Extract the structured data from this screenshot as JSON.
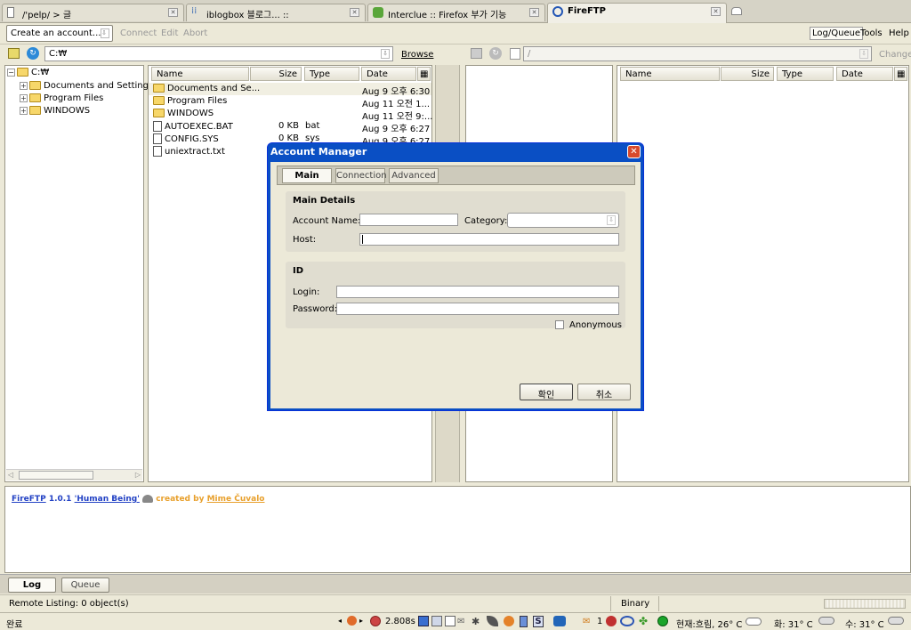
{
  "tabs": [
    {
      "label": "/'рelp/ > 글"
    },
    {
      "label": "iblogbox 블로그... ::"
    },
    {
      "label": "Interclue :: Firefox 부가 기능"
    },
    {
      "label": "FireFTP"
    }
  ],
  "toolbar": {
    "account_select": "Create an account...",
    "connect": "Connect",
    "edit": "Edit",
    "abort": "Abort",
    "log_queue": "Log/Queue",
    "tools": "Tools",
    "help": "Help"
  },
  "local": {
    "path": "C:₩",
    "browse": "Browse",
    "tree": [
      {
        "label": "C:₩"
      },
      {
        "label": "Documents and Settings"
      },
      {
        "label": "Program Files"
      },
      {
        "label": "WINDOWS"
      }
    ],
    "columns": [
      "Name",
      "Size",
      "Type",
      "Date"
    ],
    "files": [
      {
        "name": "Documents and Se...",
        "size": "",
        "type": "",
        "date": "Aug 9 오후 6:30"
      },
      {
        "name": "Program Files",
        "size": "",
        "type": "",
        "date": "Aug 11 오전 1..."
      },
      {
        "name": "WINDOWS",
        "size": "",
        "type": "",
        "date": "Aug 11 오전 9:..."
      },
      {
        "name": "AUTOEXEC.BAT",
        "size": "0 KB",
        "type": "bat",
        "date": "Aug 9 오후 6:27"
      },
      {
        "name": "CONFIG.SYS",
        "size": "0 KB",
        "type": "sys",
        "date": "Aug 9 오후 6:27"
      },
      {
        "name": "uniextract.txt",
        "size": "",
        "type": "",
        "date": ""
      }
    ]
  },
  "remote": {
    "path": "/",
    "change": "Change",
    "columns": [
      "Name",
      "Size",
      "Type",
      "Date"
    ]
  },
  "dialog": {
    "title": "Account Manager",
    "tabs": [
      "Main",
      "Connection",
      "Advanced"
    ],
    "main_details": "Main Details",
    "account_name": "Account Name:",
    "category": "Category:",
    "host": "Host:",
    "id_group": "ID",
    "login": "Login:",
    "password": "Password:",
    "anonymous": "Anonymous",
    "ok": "확인",
    "cancel": "취소"
  },
  "log": {
    "fireftp": "FireFTP",
    "version": "1.0.1",
    "codename": "'Human Being'",
    "created_by": "created by",
    "author": "Mime Čuvalo"
  },
  "bottom_tabs": {
    "log": "Log",
    "queue": "Queue"
  },
  "status": {
    "remote_listing": "Remote Listing: 0 object(s)",
    "mode": "Binary"
  },
  "taskbar": {
    "done": "완료",
    "timer": "2.808s",
    "mail_count": "1",
    "weather_now": "현재:흐림, 26° C",
    "tue": "화: 31° C",
    "wed": "수: 31° C"
  }
}
